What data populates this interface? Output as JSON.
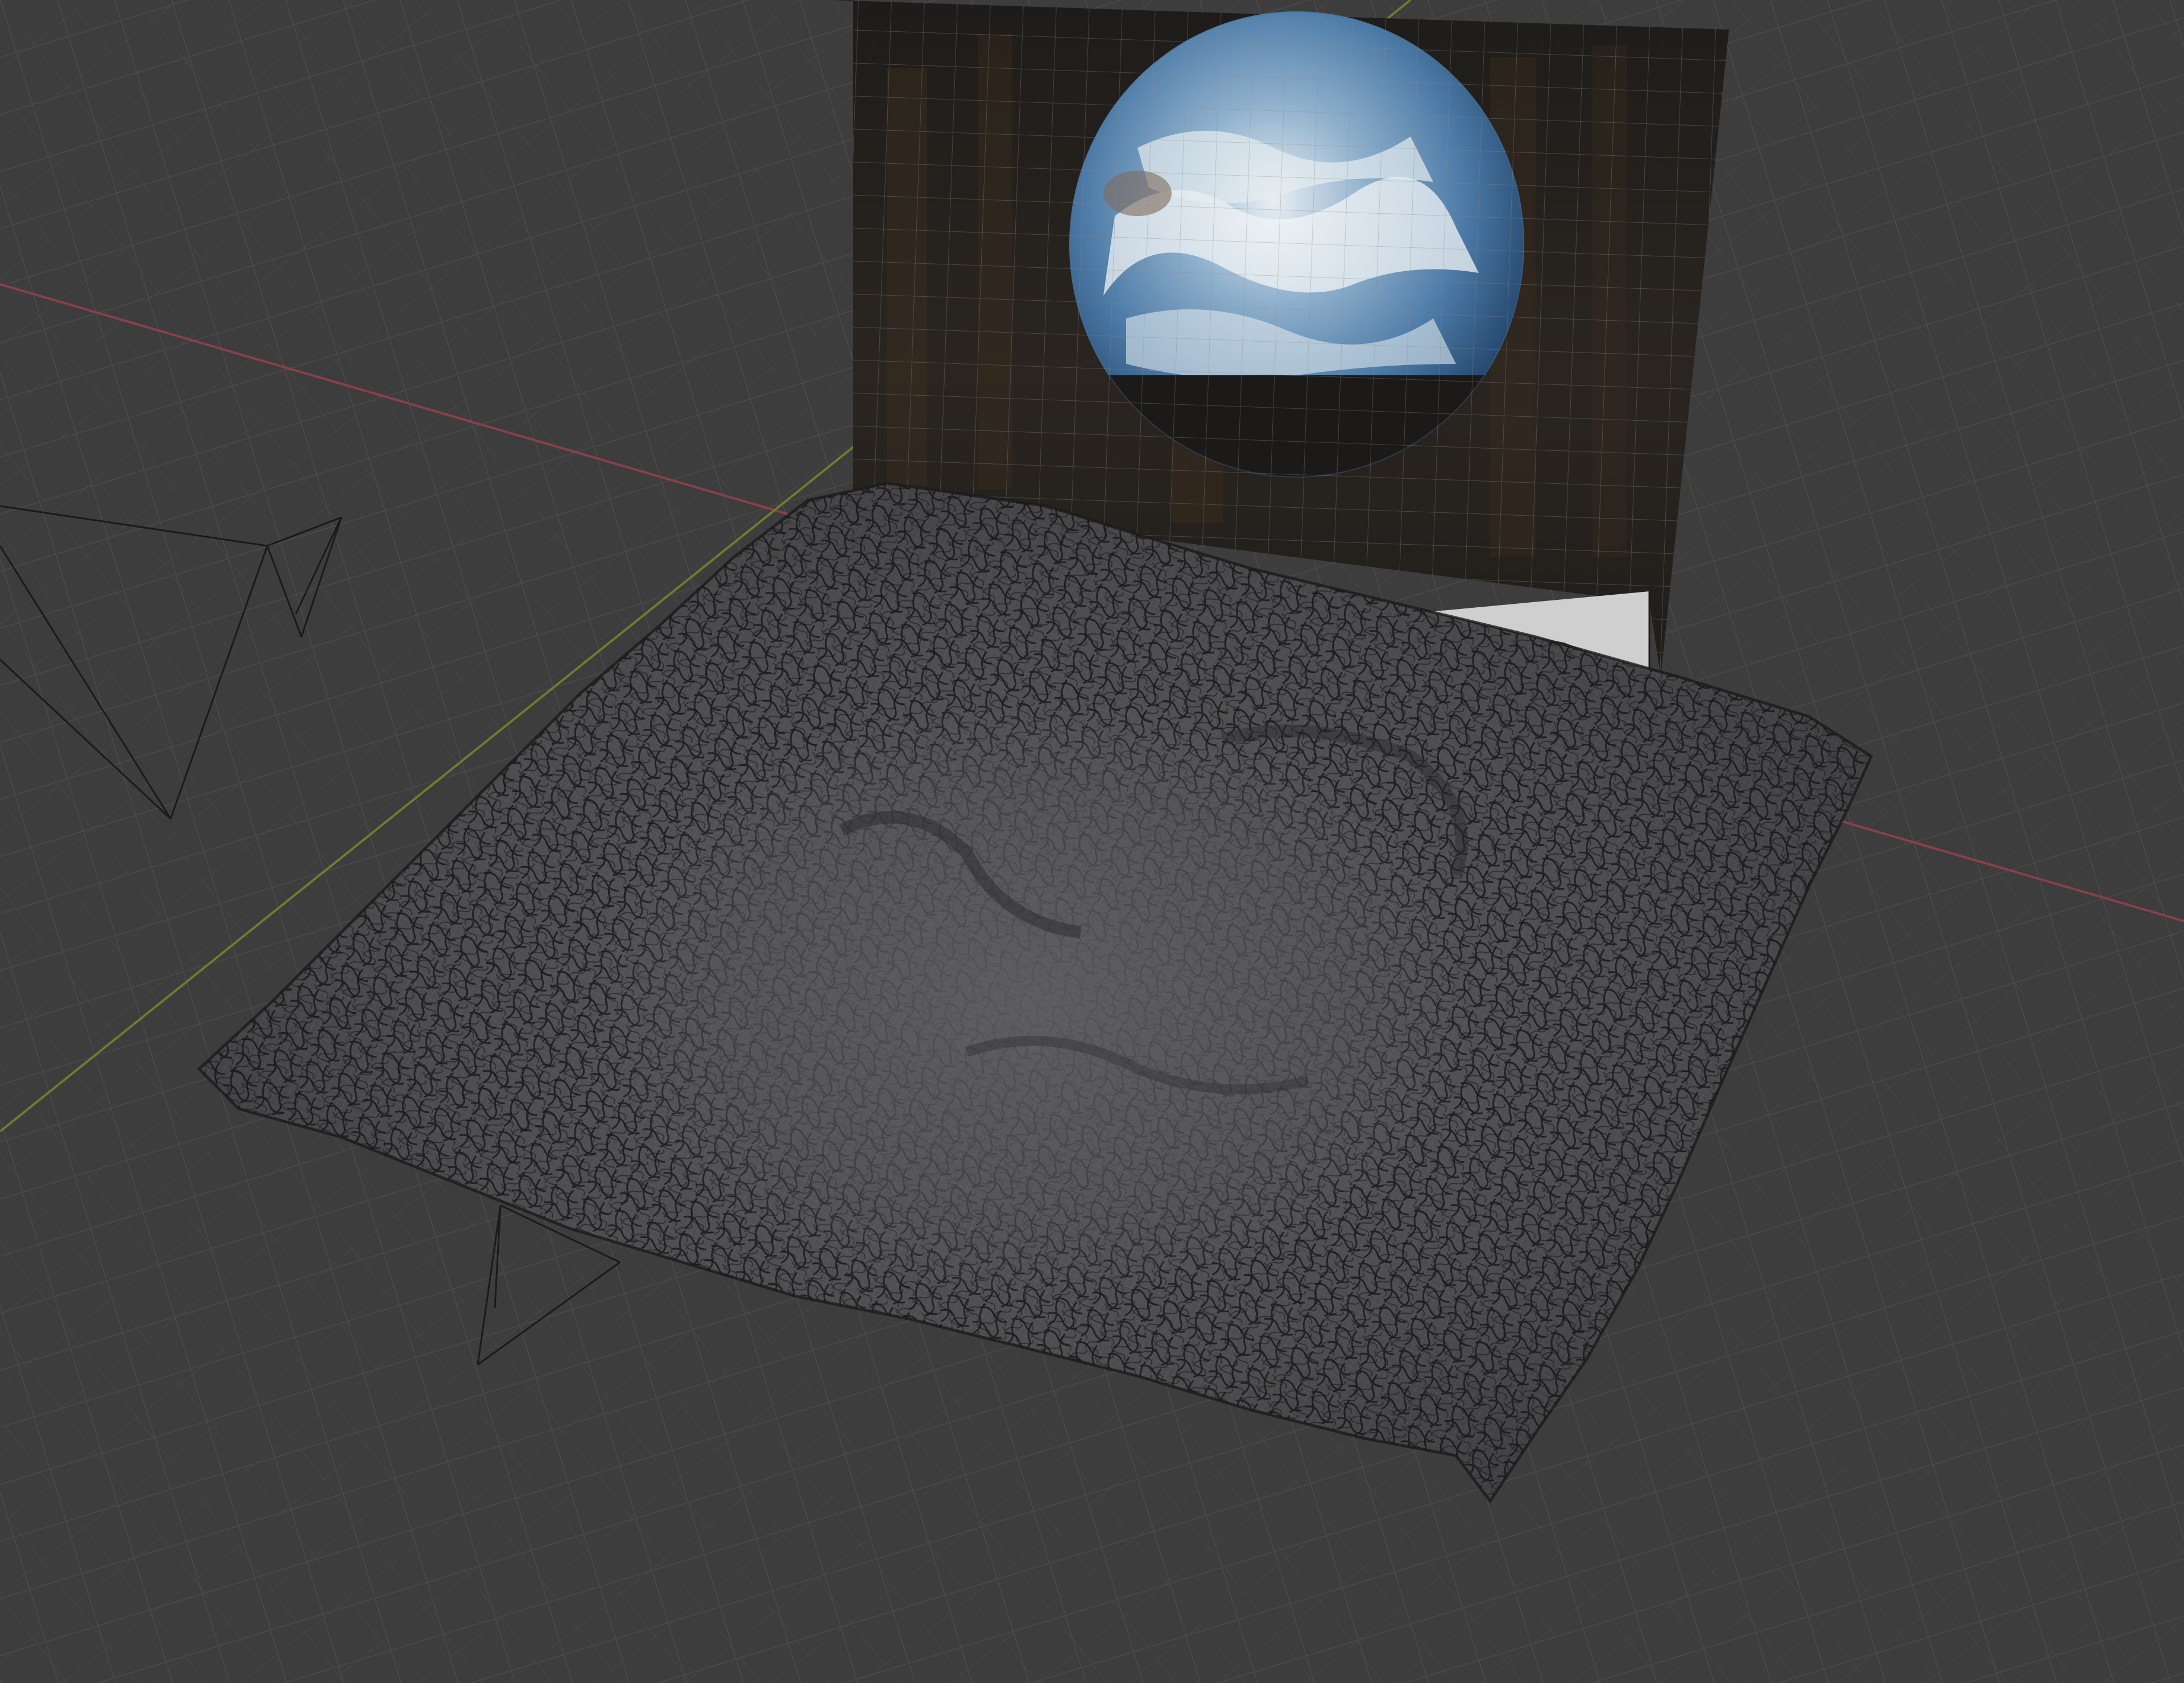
{
  "app": {
    "name": "",
    "view": "3d-viewport"
  },
  "viewport": {
    "background_color": "#3d3d3d",
    "grid_color": "#4a4a4a",
    "grid_major_color": "#525252",
    "x_axis_color": "#8c3f4b",
    "y_axis_color": "#6e7c2e"
  },
  "scene": {
    "objects": [
      {
        "name": "backdrop-plane",
        "type": "image-plane",
        "image": "earthrise-earth-over-horizon"
      },
      {
        "name": "terrain-mesh",
        "type": "displaced-plane",
        "display": "wireframe-overlay"
      },
      {
        "name": "camera-upper",
        "type": "camera",
        "display": "wire"
      },
      {
        "name": "camera-lower",
        "type": "camera",
        "display": "wire"
      }
    ]
  }
}
